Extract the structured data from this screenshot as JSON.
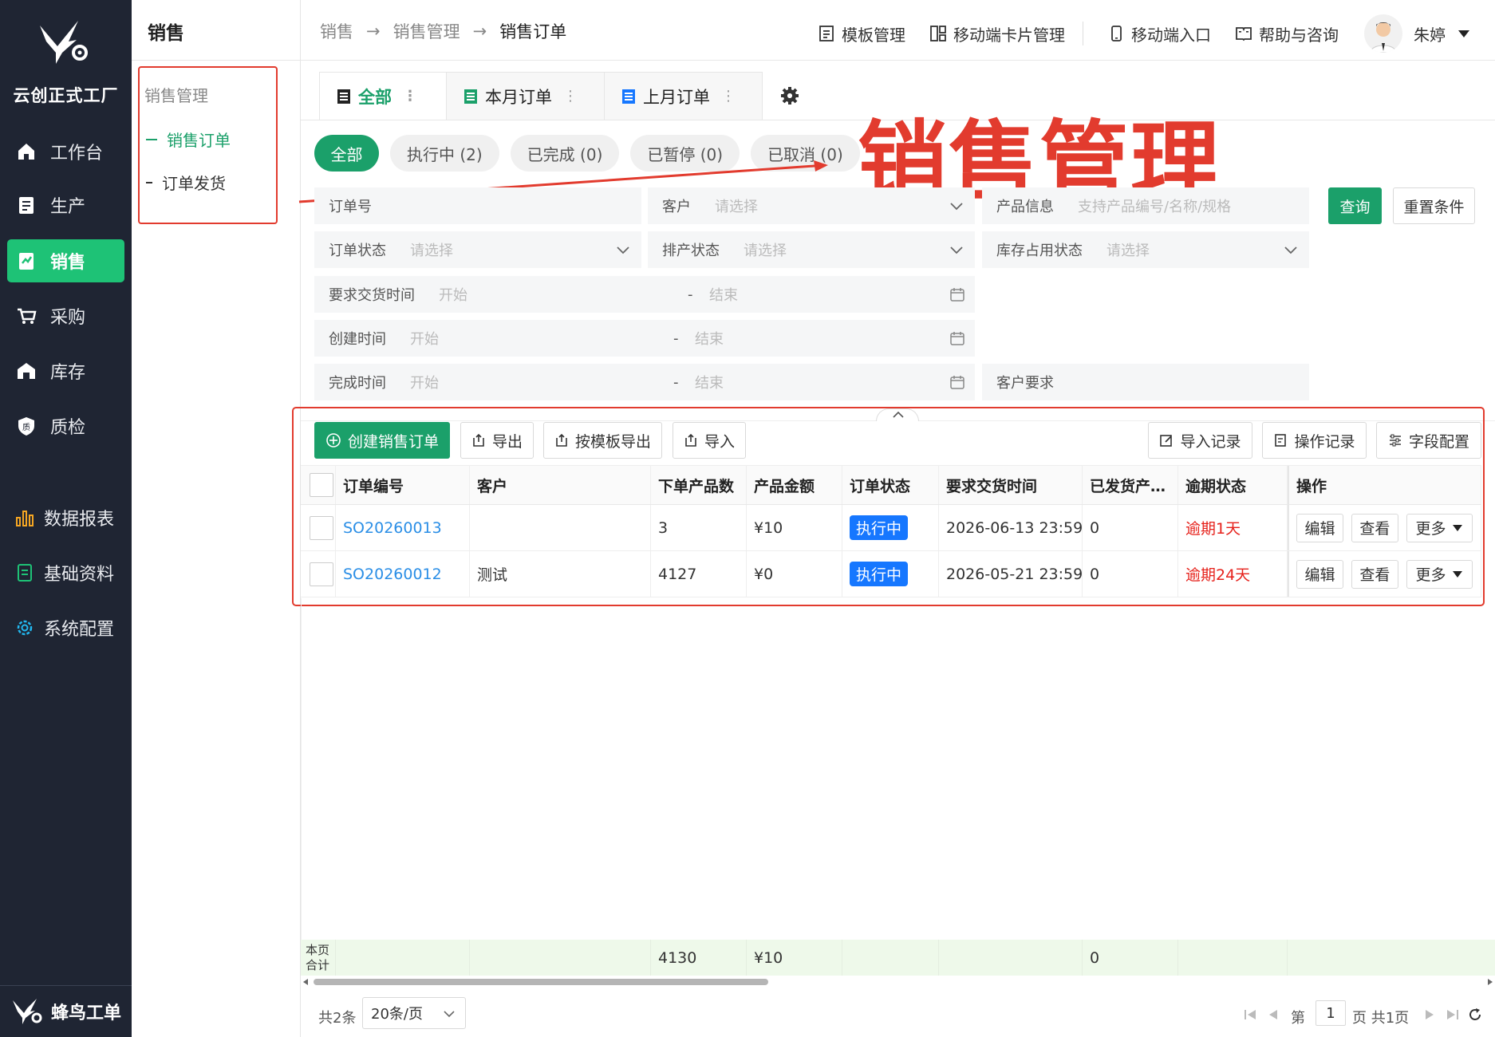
{
  "nav": {
    "brand": "云创正式工厂",
    "items": [
      {
        "label": "工作台",
        "icon": "home-icon"
      },
      {
        "label": "生产",
        "icon": "production-icon"
      },
      {
        "label": "销售",
        "icon": "sales-icon"
      },
      {
        "label": "采购",
        "icon": "cart-icon"
      },
      {
        "label": "库存",
        "icon": "warehouse-icon"
      },
      {
        "label": "质检",
        "icon": "quality-icon"
      },
      {
        "label": "数据报表",
        "icon": "chart-icon"
      },
      {
        "label": "基础资料",
        "icon": "document-icon"
      },
      {
        "label": "系统配置",
        "icon": "settings-icon"
      }
    ],
    "footer": "蜂鸟工单",
    "active_color": "#1ec276"
  },
  "submenu": {
    "title": "销售",
    "group": "销售管理",
    "items": [
      "销售订单",
      "订单发货"
    ]
  },
  "header": {
    "breadcrumb": [
      "销售",
      "销售管理",
      "销售订单"
    ],
    "links": [
      "模板管理",
      "移动端卡片管理",
      "移动端入口",
      "帮助与咨询"
    ],
    "user": "朱婷"
  },
  "view_tabs": [
    "全部",
    "本月订单",
    "上月订单"
  ],
  "status_pills": [
    "全部",
    "执行中 (2)",
    "已完成 (0)",
    "已暂停 (0)",
    "已取消 (0)"
  ],
  "annotation": "销售管理",
  "filters": {
    "order_no": "订单号",
    "customer": "客户",
    "customer_ph": "请选择",
    "product": "产品信息",
    "product_ph": "支持产品编号/名称/规格",
    "order_status": "订单状态",
    "order_status_ph": "请选择",
    "schedule_status": "排产状态",
    "schedule_status_ph": "请选择",
    "stock_status": "库存占用状态",
    "stock_status_ph": "请选择",
    "delivery_time": "要求交货时间",
    "created_time": "创建时间",
    "finished_time": "完成时间",
    "start_ph": "开始",
    "end_ph": "结束",
    "range_sep": "-",
    "customer_req": "客户要求",
    "query": "查询",
    "reset": "重置条件"
  },
  "toolbar": {
    "create": "创建销售订单",
    "export": "导出",
    "template_export": "按模板导出",
    "import": "导入",
    "import_log": "导入记录",
    "op_log": "操作记录",
    "field_config": "字段配置"
  },
  "table": {
    "columns": [
      "订单编号",
      "客户",
      "下单产品数",
      "产品金额",
      "订单状态",
      "要求交货时间",
      "已发货产…",
      "逾期状态",
      "操作"
    ],
    "rows": [
      {
        "order_no": "SO20260013",
        "customer": "",
        "qty": "3",
        "amount": "¥10",
        "status": "执行中",
        "due": "2026-06-13 23:59",
        "shipped": "0",
        "overdue": "逾期1天"
      },
      {
        "order_no": "SO20260012",
        "customer": "测试",
        "qty": "4127",
        "amount": "¥0",
        "status": "执行中",
        "due": "2026-05-21 23:59",
        "shipped": "0",
        "overdue": "逾期24天"
      }
    ],
    "actions": [
      "编辑",
      "查看",
      "更多"
    ],
    "totals": {
      "label": "本页合计",
      "qty": "4130",
      "amount": "¥10",
      "shipped": "0"
    }
  },
  "pager": {
    "total": "共2条",
    "page_size": "20条/页",
    "page_prefix": "第",
    "page": "1",
    "page_suffix": "页 共1页"
  }
}
